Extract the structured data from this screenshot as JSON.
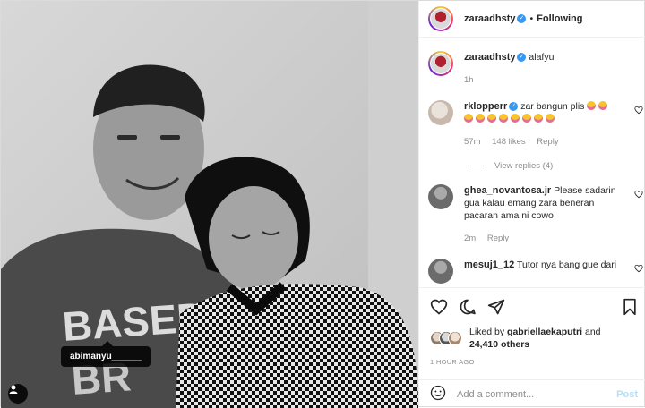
{
  "post": {
    "photo": {
      "user_tag": "abimanyu______",
      "user_tag_button_icon": "user-icon"
    }
  },
  "header": {
    "username": "zaraadhsty",
    "separator": "•",
    "follow_status": "Following"
  },
  "caption": {
    "username": "zaraadhsty",
    "text": "alafyu",
    "time": "1h"
  },
  "comments": [
    {
      "username": "rklopperr",
      "verified": true,
      "text": "zar bangun plis",
      "time": "57m",
      "likes": "148 likes",
      "reply": "Reply",
      "view_replies": "View replies (4)"
    },
    {
      "username": "ghea_novantosa.jr",
      "text": "Please sadarin gua kalau emang zara beneran pacaran ama ni cowo",
      "time": "2m",
      "reply": "Reply"
    },
    {
      "username": "mesuj1_12",
      "text": "Tutor nya bang gue dari"
    }
  ],
  "likes": {
    "prefix": "Liked by",
    "user": "gabriellaekaputri",
    "and": "and",
    "others": "24,410 others"
  },
  "time_ago": "1 HOUR AGO",
  "add_comment": {
    "placeholder": "Add a comment...",
    "post_label": "Post"
  },
  "colors": {
    "verified": "#3897f0",
    "muted": "#8e8e8e",
    "post_disabled": "#b2dffc"
  }
}
